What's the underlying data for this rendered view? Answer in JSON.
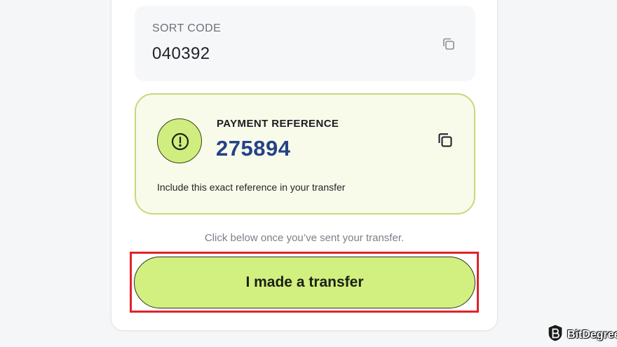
{
  "sort_code": {
    "label": "SORT CODE",
    "value": "040392",
    "copy_icon": "copy-icon"
  },
  "payment_reference": {
    "label": "PAYMENT REFERENCE",
    "value": "275894",
    "note": "Include this exact reference in your transfer",
    "alert_icon": "alert-circle-icon",
    "copy_icon": "copy-icon",
    "accent_color": "#cfee7f",
    "value_color": "#24418a"
  },
  "hint_text": "Click below once you’ve sent your transfer.",
  "transfer_button": {
    "label": "I made a transfer",
    "color": "#d1f07f",
    "highlight_color": "#e2222a"
  },
  "watermark": {
    "name": "BitDegree",
    "icon": "bitdegree-logo-icon"
  }
}
